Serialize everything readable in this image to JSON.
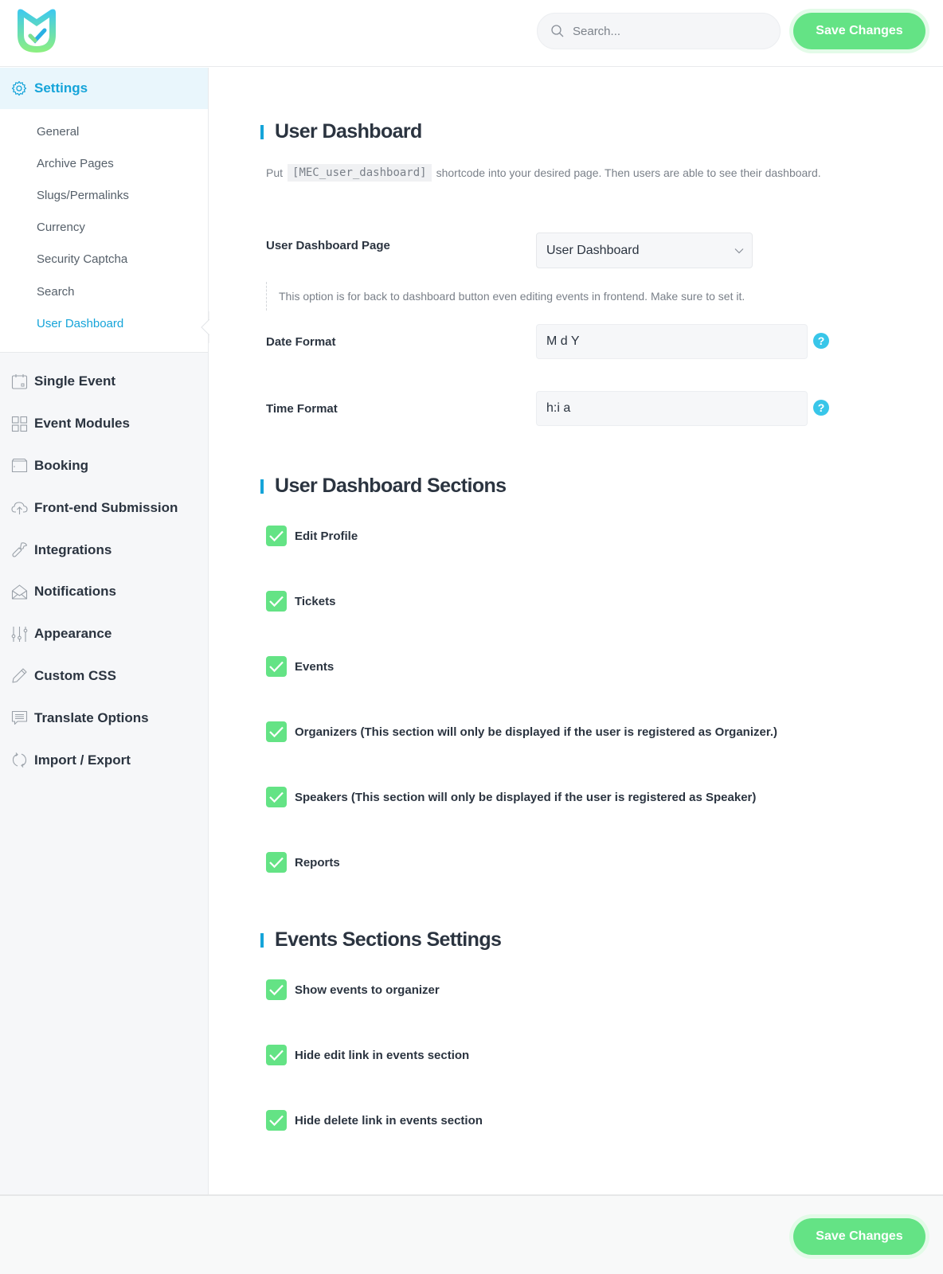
{
  "header": {
    "logo": "mec-logo",
    "search_placeholder": "Search...",
    "save_label": "Save Changes"
  },
  "sidebar": {
    "settings_label": "Settings",
    "sub_items": [
      {
        "label": "General",
        "active": false
      },
      {
        "label": "Archive Pages",
        "active": false
      },
      {
        "label": "Slugs/Permalinks",
        "active": false
      },
      {
        "label": "Currency",
        "active": false
      },
      {
        "label": "Security Captcha",
        "active": false
      },
      {
        "label": "Search",
        "active": false
      },
      {
        "label": "User Dashboard",
        "active": true
      }
    ],
    "items": [
      {
        "label": "Single Event",
        "icon": "calendar-icon"
      },
      {
        "label": "Event Modules",
        "icon": "grid-icon"
      },
      {
        "label": "Booking",
        "icon": "wallet-icon"
      },
      {
        "label": "Front-end Submission",
        "icon": "cloud-upload-icon"
      },
      {
        "label": "Integrations",
        "icon": "wrench-icon"
      },
      {
        "label": "Notifications",
        "icon": "envelope-icon"
      },
      {
        "label": "Appearance",
        "icon": "sliders-icon"
      },
      {
        "label": "Custom CSS",
        "icon": "pencil-icon"
      },
      {
        "label": "Translate Options",
        "icon": "chat-icon"
      },
      {
        "label": "Import / Export",
        "icon": "refresh-icon"
      }
    ]
  },
  "main": {
    "user_dashboard": {
      "title": "User Dashboard",
      "desc_prefix": "Put",
      "shortcode": "[MEC_user_dashboard]",
      "desc_suffix": "shortcode into your desired page. Then users are able to see their dashboard.",
      "page_label": "User Dashboard Page",
      "page_value": "User Dashboard",
      "page_hint": "This option is for back to dashboard button even editing events in frontend. Make sure to set it.",
      "date_label": "Date Format",
      "date_value": "M d Y",
      "time_label": "Time Format",
      "time_value": "h:i a",
      "help_glyph": "?"
    },
    "sections": {
      "title": "User Dashboard Sections",
      "items": [
        {
          "label": "Edit Profile",
          "checked": true
        },
        {
          "label": "Tickets",
          "checked": true
        },
        {
          "label": "Events",
          "checked": true
        },
        {
          "label": "Organizers (This section will only be displayed if the user is registered as Organizer.)",
          "checked": true
        },
        {
          "label": "Speakers (This section will only be displayed if the user is registered as Speaker)",
          "checked": true
        },
        {
          "label": "Reports",
          "checked": true
        }
      ]
    },
    "events_settings": {
      "title": "Events Sections Settings",
      "items": [
        {
          "label": "Show events to organizer",
          "checked": true
        },
        {
          "label": "Hide edit link in events section",
          "checked": true
        },
        {
          "label": "Hide delete link in events section",
          "checked": true
        }
      ]
    }
  },
  "footer": {
    "save_label": "Save Changes"
  },
  "colors": {
    "accent": "#15a4d9",
    "save_green": "#64e385",
    "help_blue": "#38c6e9"
  }
}
